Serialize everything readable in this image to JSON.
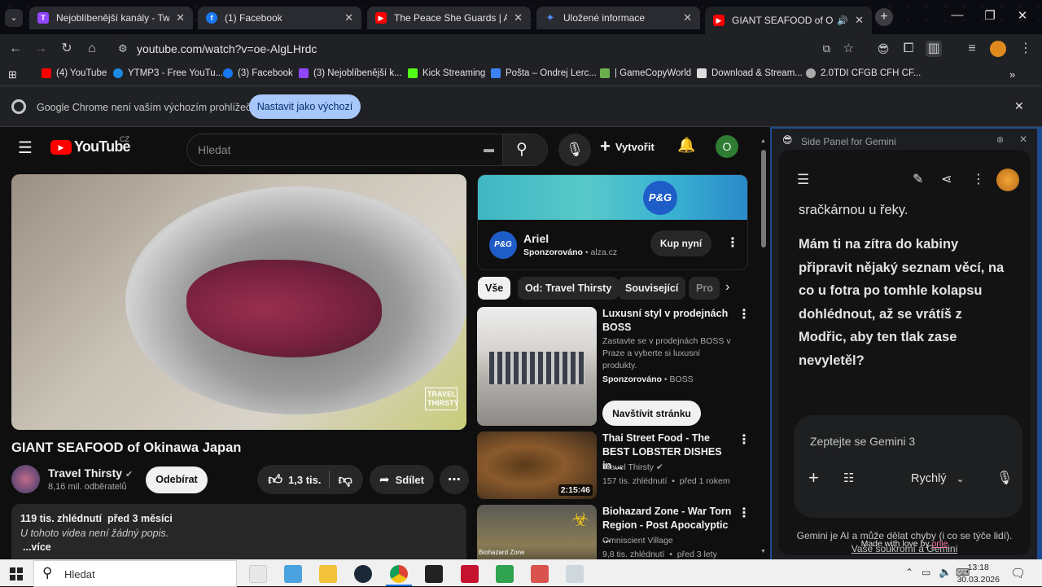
{
  "browser": {
    "tabs": [
      {
        "title": "Nejoblíbenější kanály - Twitch",
        "icon": "twitch-icon",
        "color": "#9146ff"
      },
      {
        "title": "(1) Facebook",
        "icon": "facebook-icon",
        "color": "#1877f2"
      },
      {
        "title": "The Peace She Guards | Ambien",
        "icon": "youtube-icon",
        "color": "#ff0000"
      },
      {
        "title": "Uložené informace",
        "icon": "gemini-icon",
        "color": "#4f8ff7"
      },
      {
        "title": "GIANT SEAFOOD of Okinaw",
        "icon": "youtube-icon",
        "color": "#ff0000",
        "active": true
      }
    ],
    "url": "youtube.com/watch?v=oe-AlgLHrdc",
    "bookmarks": [
      {
        "label": "(4) YouTube",
        "color": "#ff0000"
      },
      {
        "label": "YTMP3 - Free YouTu...",
        "color": "#1e88e5"
      },
      {
        "label": "(3) Facebook",
        "color": "#1877f2"
      },
      {
        "label": "(3) Nejoblíbenější k...",
        "color": "#9146ff"
      },
      {
        "label": "Kick Streaming",
        "color": "#53fc18"
      },
      {
        "label": "Pošta – Ondrej Lerc...",
        "color": "#3b82f6"
      },
      {
        "label": "| GameCopyWorld",
        "color": "#6ab04c"
      },
      {
        "label": "Download & Stream...",
        "color": "#dddddd"
      },
      {
        "label": "2.0TDI CFGB CFH CF...",
        "color": "#aaaaaa"
      }
    ],
    "infobar": {
      "message": "Google Chrome není vaším výchozím prohlížečem",
      "button": "Nastavit jako výchozí"
    }
  },
  "youtube": {
    "logo_text": "YouTube",
    "region": "CZ",
    "search_placeholder": "Hledat",
    "create_label": "Vytvořit",
    "avatar_letter": "O",
    "video": {
      "title": "GIANT SEAFOOD of Okinawa Japan",
      "watermark": "TRAVEL THIRSTY",
      "channel": "Travel Thirsty",
      "subscribers": "8,16 mil. odběratelů",
      "subscribe_label": "Odebírat",
      "likes": "1,3 tis.",
      "share_label": "Sdílet",
      "views_date": "119 tis. zhlédnutí  před 3 měsíci",
      "description": "U tohoto videa není žádný popis.",
      "more_label": "...více"
    },
    "ad": {
      "brand": "Ariel",
      "brand_logo": "P&G",
      "sponsored": "Sponzorováno",
      "domain": "alza.cz",
      "cta": "Kup nyní"
    },
    "chips": [
      "Vše",
      "Od: Travel Thirsty",
      "Související",
      "Pro"
    ],
    "related": [
      {
        "title": "Luxusní styl v prodejnách BOSS",
        "desc": "Zastavte se v prodejnách BOSS v Praze a vyberte si luxusní produkty.",
        "sponsored": "Sponzorováno",
        "advertiser": "BOSS",
        "cta": "Navštívit stránku"
      },
      {
        "title": "Thai Street Food - The BEST LOBSTER DISHES in ...",
        "channel": "Travel Thirsty",
        "meta": "157 tis. zhlédnutí  •  před 1 rokem",
        "duration": "2:15:46"
      },
      {
        "title": "Biohazard Zone - War Torn Region - Post Apocalyptic ...",
        "channel": "Omniscient Village",
        "meta": "9,8 tis. zhlédnutí  •  před 3 lety",
        "thumb_label": "Biohazard Zone"
      }
    ]
  },
  "gemini": {
    "panel_title": "Side Panel for Gemini",
    "message_partial": "sračkárnou u řeky.",
    "message": "Mám ti na zítra do kabiny připravit nějaký seznam věcí, na co u fotra po tomhle kolapsu dohlédnout, až se vrátíš z Modřic, aby ten tlak zase nevyletěl?",
    "input_placeholder": "Zeptejte se Gemini 3",
    "mode": "Rychlý",
    "disclaimer": "Gemini je AI a může dělat chyby (i co se týče lidí).",
    "privacy_link": "Vaše soukromí a Gemini",
    "made_with_love": "Made with love by",
    "author": "orlie"
  },
  "taskbar": {
    "search_placeholder": "Hledat",
    "time": "13:18",
    "date": "30.03.2026"
  }
}
